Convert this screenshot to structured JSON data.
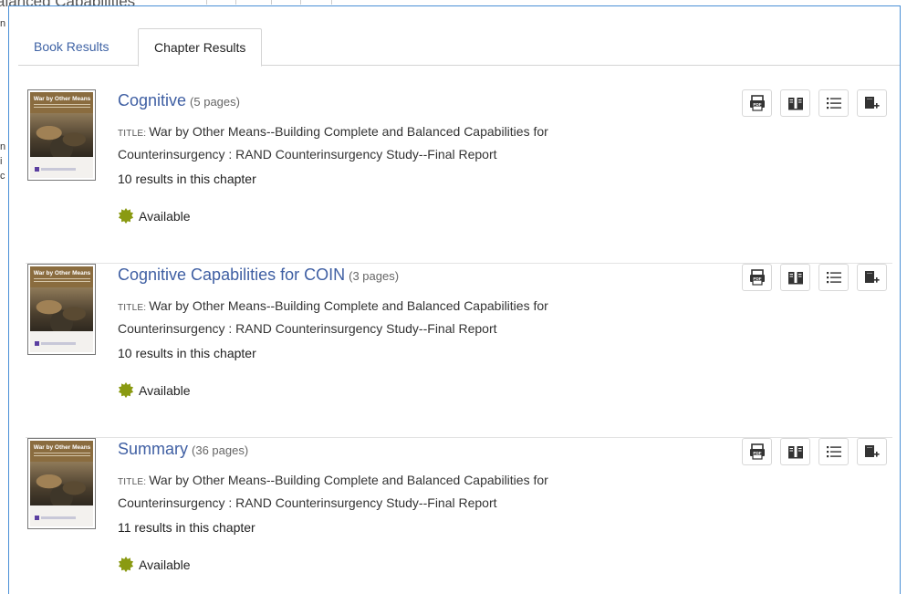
{
  "background": {
    "partial_title": "alanced Capabilities",
    "partial_letters": [
      "n",
      "n",
      "i",
      "c"
    ]
  },
  "tabs": [
    {
      "label": "Book Results",
      "active": false
    },
    {
      "label": "Chapter Results",
      "active": true
    }
  ],
  "results": [
    {
      "chapter_title": "Cognitive",
      "pages": "(5 pages)",
      "title_label": "TITLE:",
      "book_title": "War by Other Means--Building Complete and Balanced Capabilities for Counterinsurgency : RAND Counterinsurgency Study--Final Report",
      "results_count": "10 results in this chapter",
      "availability": "Available",
      "cover_title": "War by Other Means"
    },
    {
      "chapter_title": "Cognitive Capabilities for COIN",
      "pages": "(3 pages)",
      "title_label": "TITLE:",
      "book_title": "War by Other Means--Building Complete and Balanced Capabilities for Counterinsurgency : RAND Counterinsurgency Study--Final Report",
      "results_count": "10 results in this chapter",
      "availability": "Available",
      "cover_title": "War by Other Means"
    },
    {
      "chapter_title": "Summary",
      "pages": "(36 pages)",
      "title_label": "TITLE:",
      "book_title": "War by Other Means--Building Complete and Balanced Capabilities for Counterinsurgency : RAND Counterinsurgency Study--Final Report",
      "results_count": "11 results in this chapter",
      "availability": "Available",
      "cover_title": "War by Other Means"
    }
  ],
  "actions": [
    {
      "icon": "pdf-download-icon",
      "glyph": "PDF"
    },
    {
      "icon": "open-book-icon"
    },
    {
      "icon": "table-of-contents-icon"
    },
    {
      "icon": "add-to-list-icon"
    }
  ],
  "colors": {
    "accent_link": "#3f5fa3",
    "panel_border": "#4a8fd6",
    "available_badge": "#8a9a12"
  }
}
